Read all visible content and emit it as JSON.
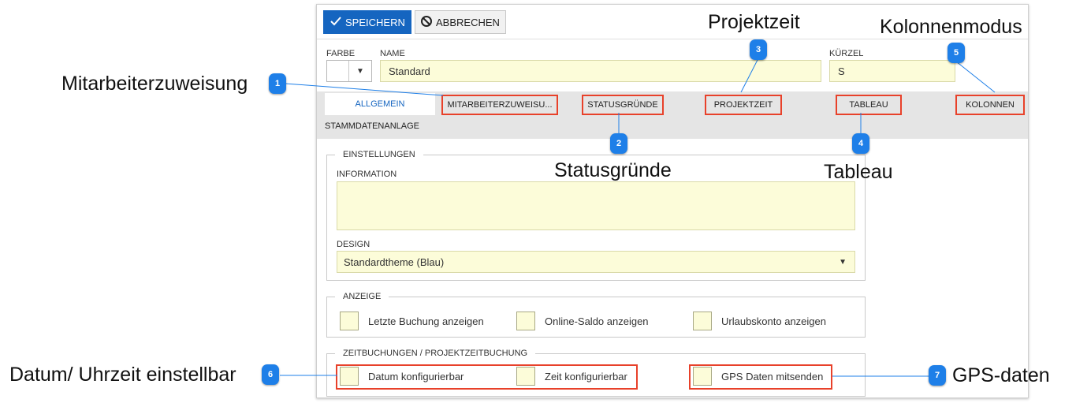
{
  "toolbar": {
    "save_label": "SPEICHERN",
    "cancel_label": "ABBRECHEN"
  },
  "header": {
    "farbe_label": "FARBE",
    "name_label": "NAME",
    "name_value": "Standard",
    "kuerzel_label": "KÜRZEL",
    "kuerzel_value": "S"
  },
  "tabs": [
    {
      "label": "ALLGEMEIN"
    },
    {
      "label": "MITARBEITERZUWEISU..."
    },
    {
      "label": "STATUSGRÜNDE"
    },
    {
      "label": "PROJEKTZEIT"
    },
    {
      "label": "TABLEAU"
    },
    {
      "label": "KOLONNEN"
    },
    {
      "label": "STAMMDATENANLAGE"
    }
  ],
  "einstellungen": {
    "legend": "EINSTELLUNGEN",
    "information_label": "INFORMATION",
    "information_value": "",
    "design_label": "DESIGN",
    "design_value": "Standardtheme (Blau)"
  },
  "anzeige": {
    "legend": "ANZEIGE",
    "options": [
      "Letzte Buchung anzeigen",
      "Online-Saldo anzeigen",
      "Urlaubskonto anzeigen"
    ]
  },
  "zeitbuchungen": {
    "legend": "ZEITBUCHUNGEN / PROJEKTZEITBUCHUNG",
    "options": [
      "Datum konfigurierbar",
      "Zeit konfigurierbar",
      "GPS Daten mitsenden"
    ]
  },
  "annotations": [
    {
      "num": "1",
      "label": "Mitarbeiterzuweisung"
    },
    {
      "num": "2",
      "label": "Statusgründe"
    },
    {
      "num": "3",
      "label": "Projektzeit"
    },
    {
      "num": "4",
      "label": "Tableau"
    },
    {
      "num": "5",
      "label": "Kolonnenmodus"
    },
    {
      "num": "6",
      "label": "Datum/ Uhrzeit einstellbar"
    },
    {
      "num": "7",
      "label": "GPS-daten"
    }
  ],
  "colors": {
    "accent": "#1565c0",
    "highlight": "#e8412a",
    "badge": "#1e7fe8",
    "field": "#fcfcd9"
  }
}
